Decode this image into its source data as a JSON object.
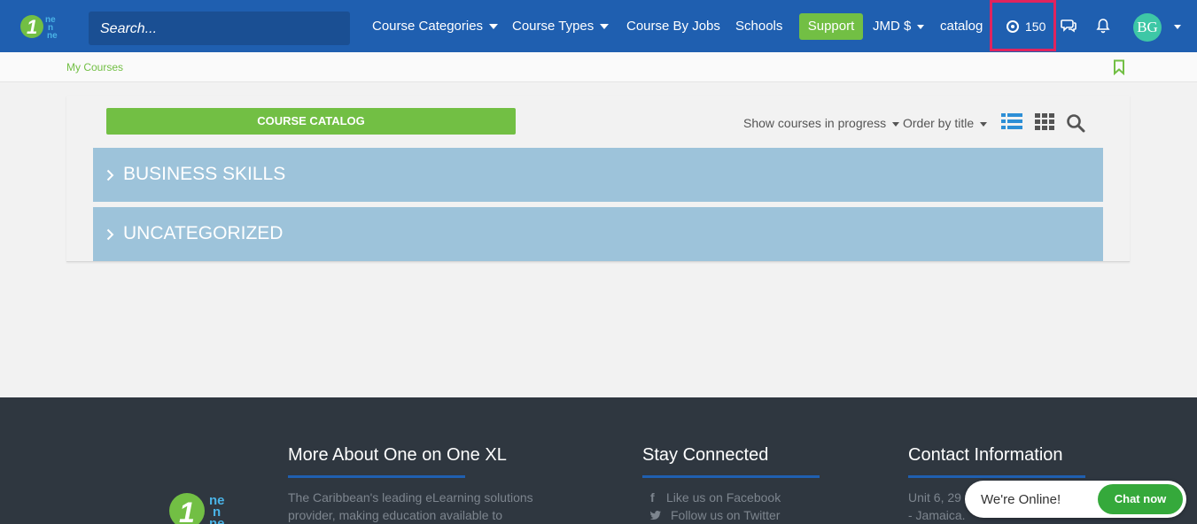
{
  "header": {
    "logo_text": "1 ne ne",
    "search_placeholder": "Search...",
    "nav": {
      "course_categories": "Course Categories",
      "course_types": "Course Types",
      "course_by_jobs": "Course By Jobs",
      "schools": "Schools"
    },
    "support_label": "Support",
    "currency_label": "JMD $",
    "catalog_label": "catalog",
    "points_value": "150",
    "avatar_initials": "BG"
  },
  "breadcrumb": {
    "current": "My Courses"
  },
  "toolbar": {
    "catalog_button": "COURSE CATALOG",
    "filter_progress": "Show courses in progress",
    "order_by": "Order by title"
  },
  "categories": [
    {
      "label": "BUSINESS SKILLS"
    },
    {
      "label": "UNCATEGORIZED"
    }
  ],
  "footer": {
    "about": {
      "heading": "More About One on One XL",
      "line1": "The Caribbean's leading eLearning solutions",
      "line2": "provider, making education available to"
    },
    "social": {
      "heading": "Stay Connected",
      "facebook": "Like us on Facebook",
      "twitter": "Follow us on Twitter"
    },
    "contact": {
      "heading": "Contact Information",
      "line1": "Unit 6, 29",
      "line2": "- Jamaica."
    }
  },
  "chat_widget": {
    "status": "We're Online!",
    "button": "Chat now"
  },
  "colors": {
    "header_bg": "#1f5fb0",
    "accent_green": "#72bf44",
    "category_row": "#9dc3da",
    "highlight_border": "#e0245e",
    "footer_bg": "#2f3740"
  }
}
